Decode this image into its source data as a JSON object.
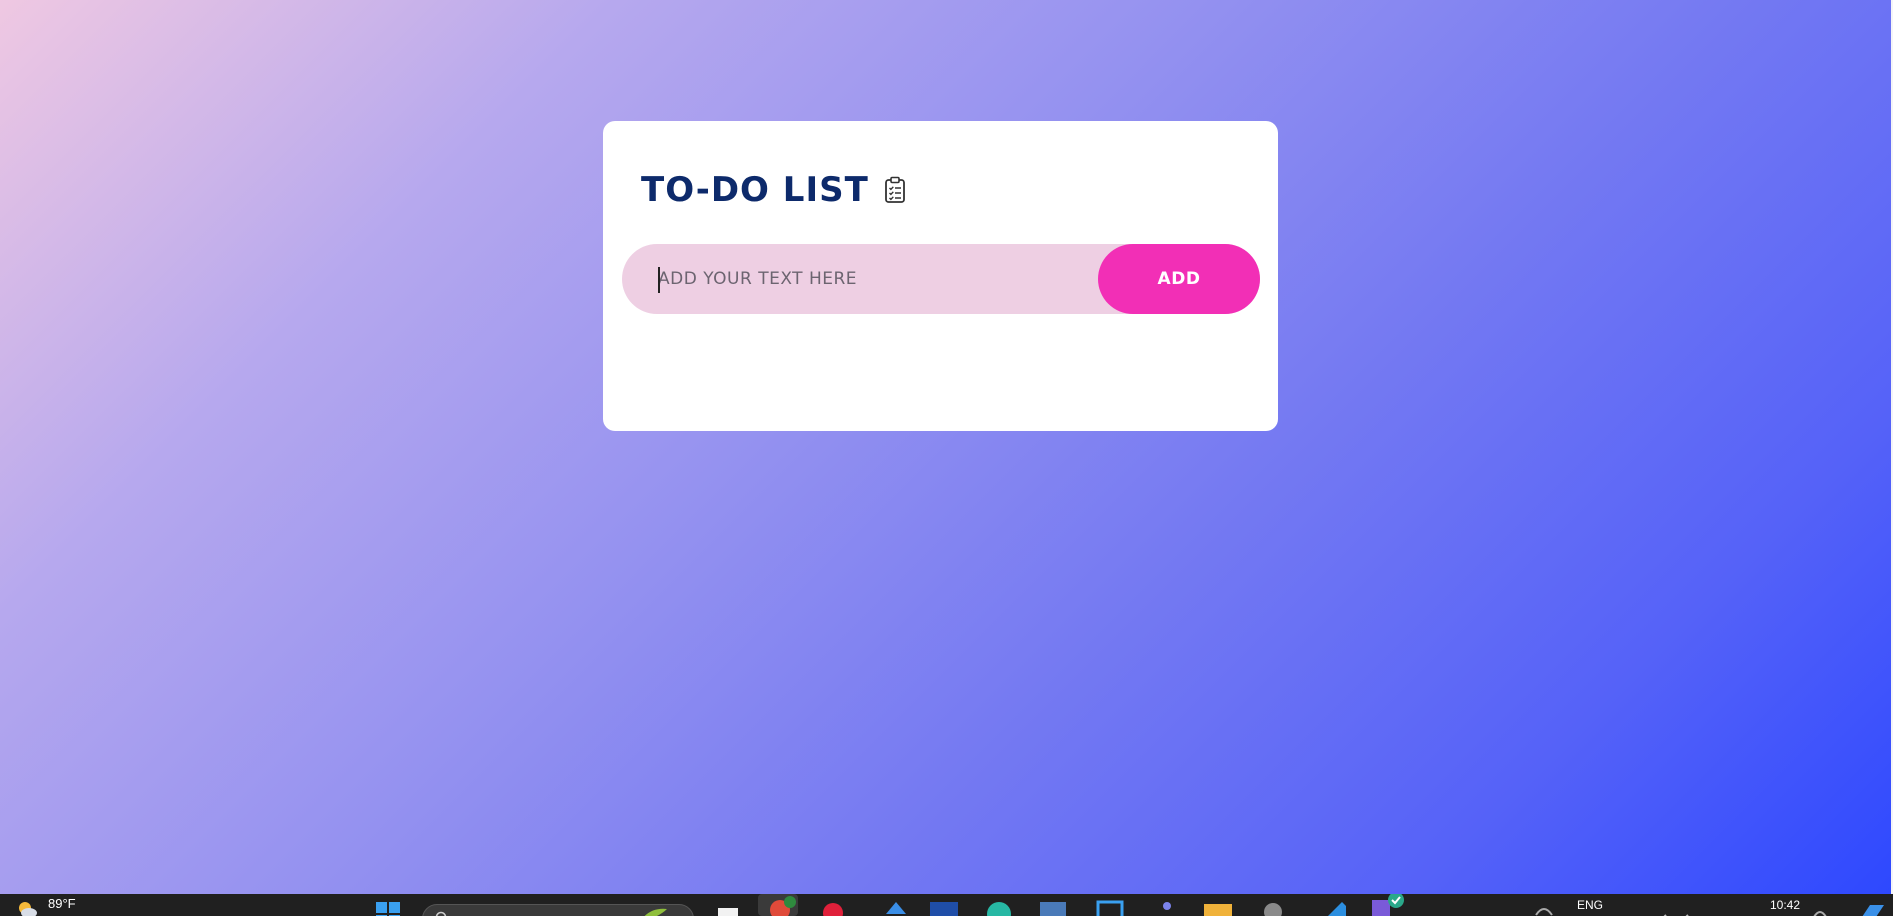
{
  "app": {
    "title": "TO-DO LIST",
    "title_icon": "clipboard-checklist-icon"
  },
  "todo_input": {
    "value": "",
    "placeholder": "ADD YOUR TEXT HERE"
  },
  "add_button": {
    "label": "ADD"
  },
  "colors": {
    "title": "#0d2a6b",
    "input_background": "#eecfe3",
    "add_button": "#f22fb6",
    "card": "#ffffff",
    "gradient_start": "#efc8e2",
    "gradient_end": "#2c47ff",
    "taskbar": "#202020"
  },
  "taskbar": {
    "weather_temp": "89°F",
    "weather_icon": "partly-sunny-icon",
    "language": "ENG",
    "time": "10:42",
    "pinned_icons": [
      "windows-start-icon",
      "search-box",
      "file-explorer-icon",
      "chrome-icon",
      "opera-icon",
      "visual-studio-icon",
      "word-icon",
      "edge-icon",
      "snipping-tool-icon",
      "control-panel-icon",
      "teams-icon",
      "folder-icon",
      "settings-icon",
      "vscode-icon",
      "app-icon"
    ]
  }
}
